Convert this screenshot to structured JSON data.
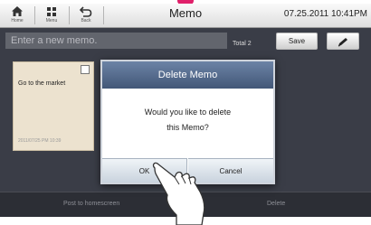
{
  "nav": {
    "home_label": "Home",
    "menu_label": "Menu",
    "back_label": "Back"
  },
  "header": {
    "title": "Memo",
    "datetime": "07.25.2011 10:41PM"
  },
  "memo_input": {
    "placeholder": "Enter a new memo.",
    "value": ""
  },
  "total": {
    "label": "Total",
    "count": "2"
  },
  "save_label": "Save",
  "memos": [
    {
      "title": "Go to the market",
      "date": "2011/07/25 PM 10:39",
      "checked": false
    }
  ],
  "bottom_bar": {
    "post_label": "Post to homescreen",
    "delete_label": "Delete"
  },
  "dialog": {
    "title": "Delete Memo",
    "message_line1": "Would you like to delete",
    "message_line2": "this Memo?",
    "ok_label": "OK",
    "cancel_label": "Cancel"
  },
  "colors": {
    "accent": "#e0206a",
    "dialog_header": "#52678a",
    "memo_area_bg": "#3a3d47",
    "memo_card": "#ece2cf"
  },
  "icons": [
    "home-icon",
    "menu-grid-icon",
    "back-icon",
    "pen-icon",
    "checkbox-icon",
    "hand-pointer-icon"
  ]
}
